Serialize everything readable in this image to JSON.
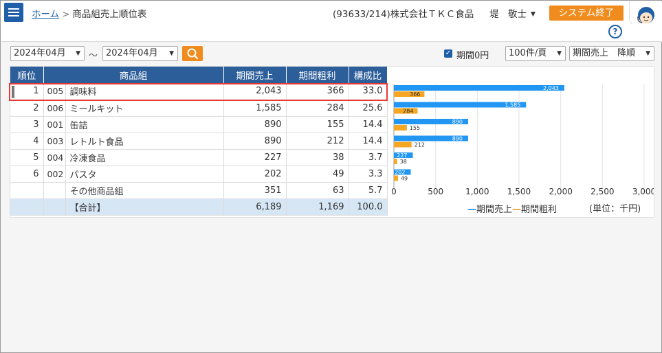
{
  "header": {
    "breadcrumb_home": "ホーム",
    "breadcrumb_sep": ">",
    "page_title": "商品組売上順位表",
    "company": "(93633/214)株式会社ＴＫＣ食品",
    "user": "堤　敬士",
    "exit_label": "システム終了",
    "help_label": "?"
  },
  "filters": {
    "from_month": "2024年04月",
    "tilde": "～",
    "to_month": "2024年04月",
    "zero_label": "期間0円",
    "zero_checked": true,
    "per_page": "100件/頁",
    "sort": "期間売上　降順"
  },
  "table": {
    "headers": [
      "順位",
      "商品組",
      "期間売上",
      "期間粗利",
      "構成比"
    ],
    "rows": [
      {
        "rank": "1",
        "code": "005",
        "name": "調味料",
        "sales": "2,043",
        "profit": "366",
        "ratio": "33.0"
      },
      {
        "rank": "2",
        "code": "006",
        "name": "ミールキット",
        "sales": "1,585",
        "profit": "284",
        "ratio": "25.6"
      },
      {
        "rank": "3",
        "code": "001",
        "name": "缶詰",
        "sales": "890",
        "profit": "155",
        "ratio": "14.4"
      },
      {
        "rank": "4",
        "code": "003",
        "name": "レトルト食品",
        "sales": "890",
        "profit": "212",
        "ratio": "14.4"
      },
      {
        "rank": "5",
        "code": "004",
        "name": "冷凍食品",
        "sales": "227",
        "profit": "38",
        "ratio": "3.7"
      },
      {
        "rank": "6",
        "code": "002",
        "name": "パスタ",
        "sales": "202",
        "profit": "49",
        "ratio": "3.3"
      },
      {
        "rank": "",
        "code": "",
        "name": "その他商品組",
        "sales": "351",
        "profit": "63",
        "ratio": "5.7"
      }
    ],
    "total": {
      "name": "【合計】",
      "sales": "6,189",
      "profit": "1,169",
      "ratio": "100.0"
    }
  },
  "chart_data": {
    "type": "bar",
    "orientation": "horizontal",
    "categories": [
      "調味料",
      "ミールキット",
      "缶詰",
      "レトルト食品",
      "冷凍食品",
      "パスタ"
    ],
    "series": [
      {
        "name": "期間売上",
        "values": [
          2043,
          1585,
          890,
          890,
          227,
          202
        ],
        "color": "#2196f3"
      },
      {
        "name": "期間粗利",
        "values": [
          366,
          284,
          155,
          212,
          38,
          49
        ],
        "color": "#f5a623"
      }
    ],
    "xlim": [
      0,
      3000
    ],
    "xticks": [
      "0",
      "500",
      "1,000",
      "1,500",
      "2,000",
      "2,500",
      "3,000"
    ],
    "unit_label": "(単位：千円)",
    "grid": true,
    "legend": "bottom"
  },
  "colors": {
    "accent": "#1f5fa8",
    "header": "#2c5e9a",
    "orange": "#f08c1e",
    "highlight": "#e53935"
  }
}
